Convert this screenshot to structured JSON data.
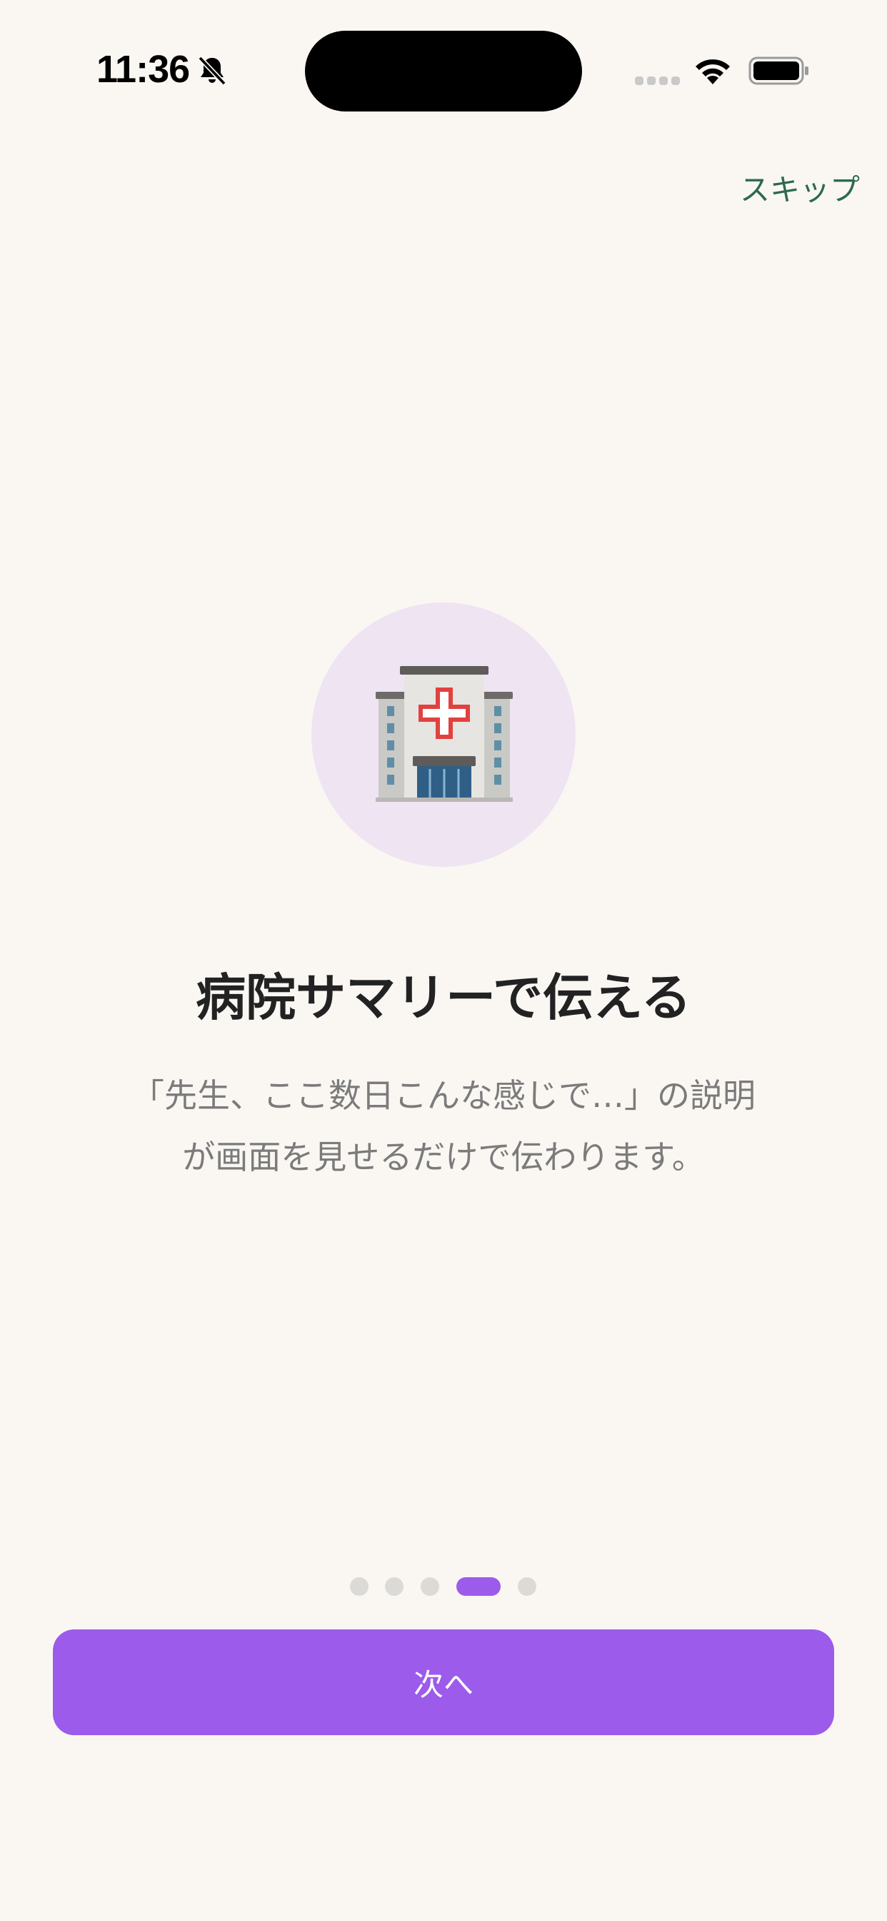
{
  "status_bar": {
    "time": "11:36"
  },
  "header": {
    "skip_label": "スキップ"
  },
  "slide": {
    "icon": "hospital-icon",
    "title": "病院サマリーで伝える",
    "description_line1": "「先生、ここ数日こんな感じで…」の説明",
    "description_line2": "が画面を見せるだけで伝わります。"
  },
  "pager": {
    "total": 5,
    "current": 4
  },
  "footer": {
    "next_label": "次へ"
  },
  "colors": {
    "accent": "#9c5bea",
    "skip": "#2e6a4c",
    "background": "#faf7f3",
    "icon_circle": "#efe4f2"
  }
}
